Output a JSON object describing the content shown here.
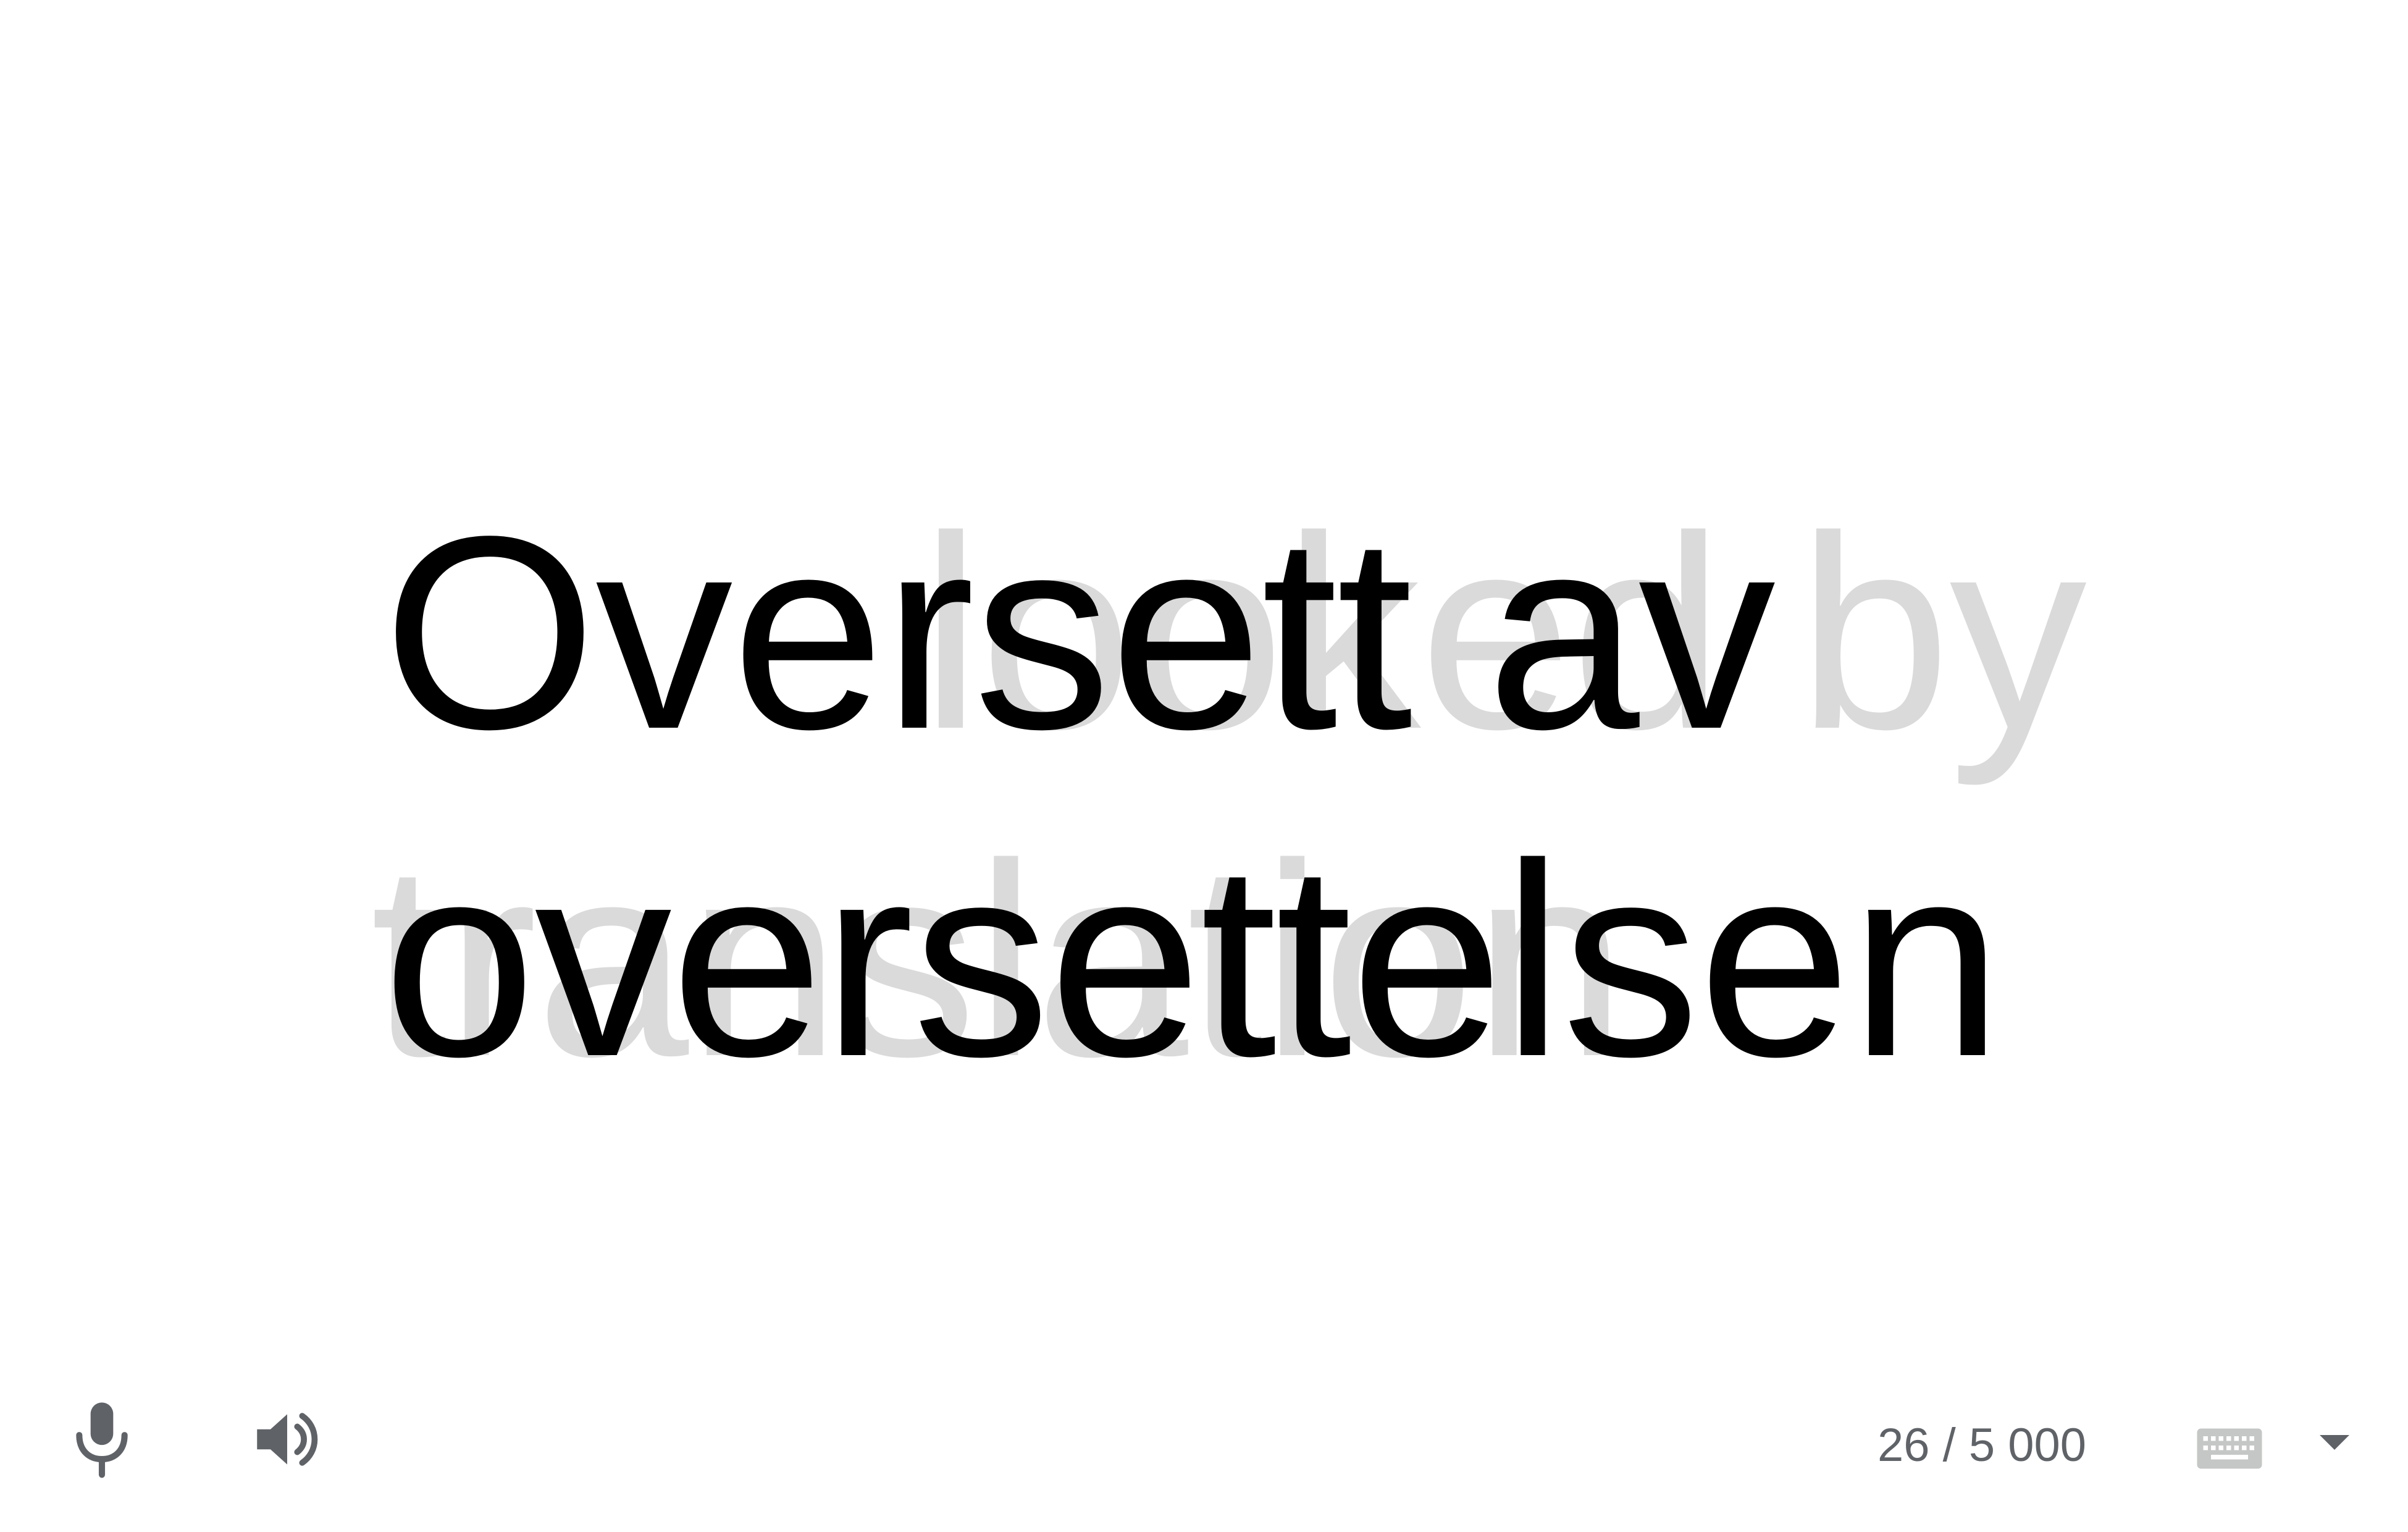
{
  "source": {
    "text": "Oversett av oversettelsen",
    "ghost_text": "looked by translation"
  },
  "toolbar": {
    "mic_icon": "microphone-icon",
    "speaker_icon": "speaker-icon",
    "char_count": "26 / 5 000",
    "keyboard_icon": "keyboard-icon",
    "dropdown_icon": "caret-down-icon"
  },
  "colors": {
    "text": "#000000",
    "ghost": "#dadada",
    "icon": "#5f6368",
    "keyboard": "#c4c7c5"
  }
}
